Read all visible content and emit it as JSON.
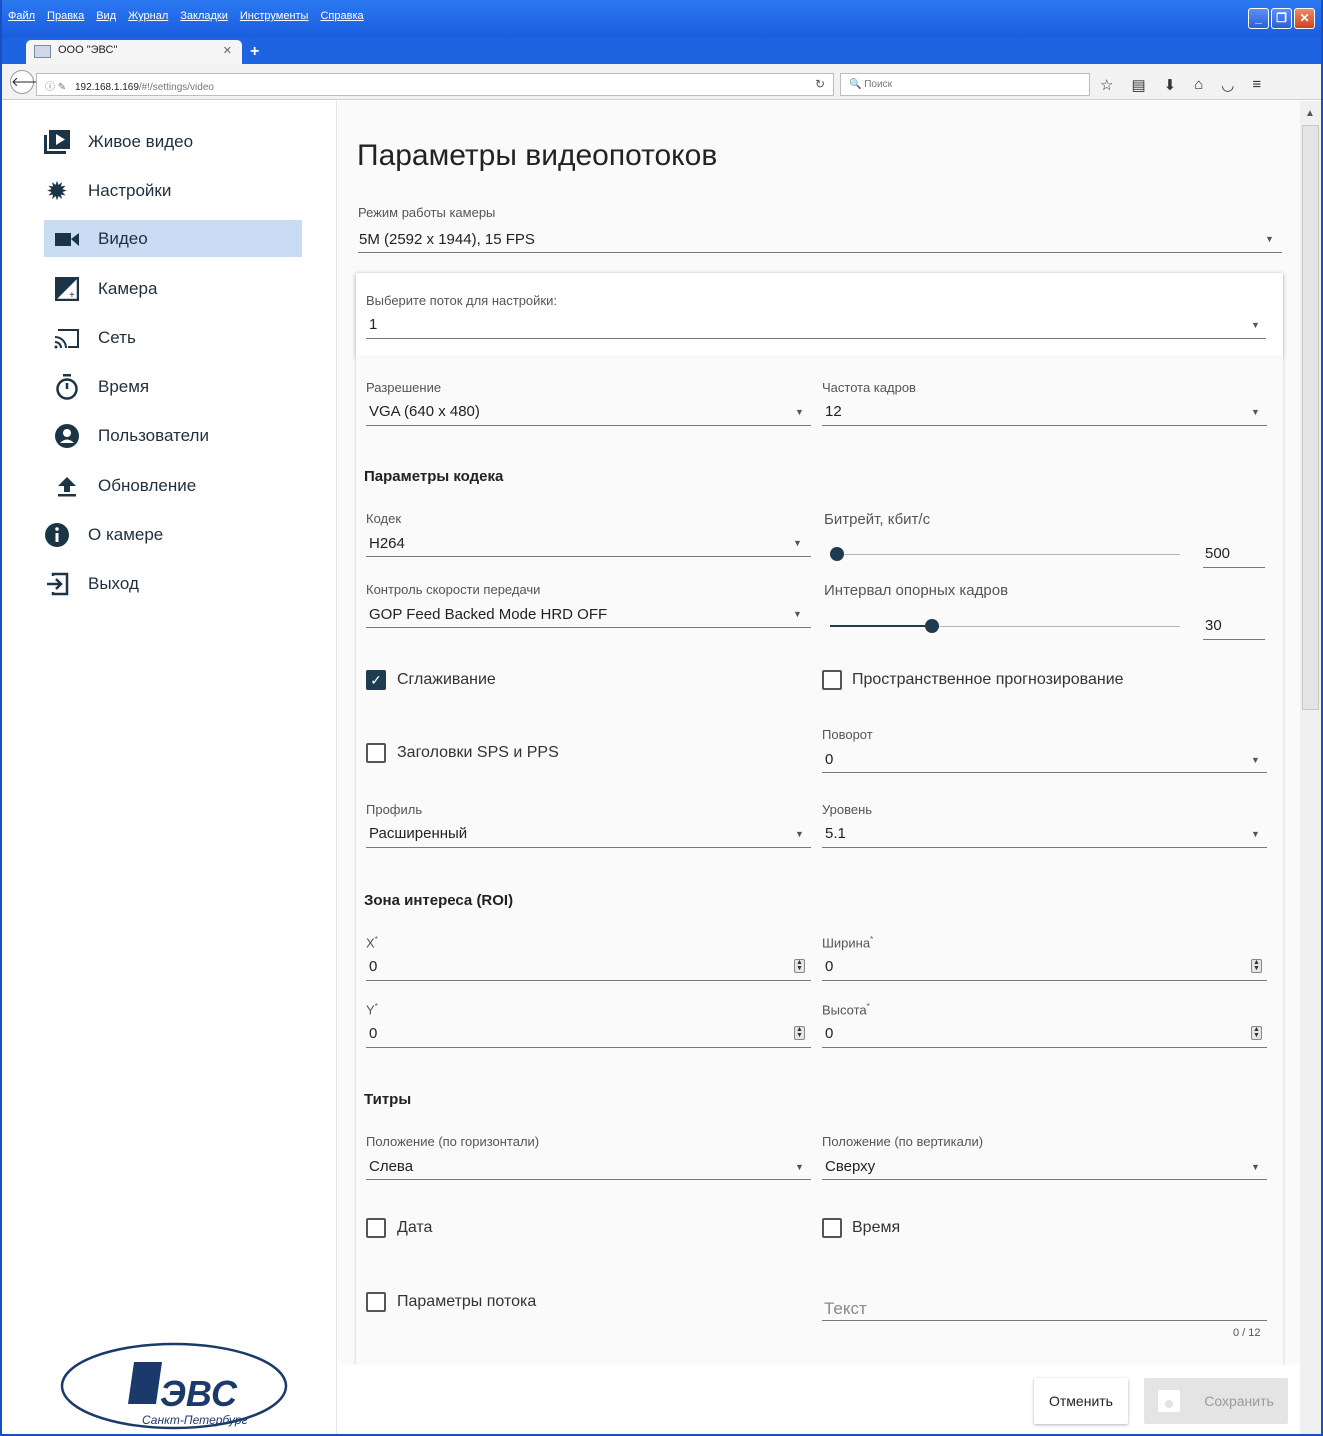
{
  "browser": {
    "menu": [
      "Файл",
      "Правка",
      "Вид",
      "Журнал",
      "Закладки",
      "Инструменты",
      "Справка"
    ],
    "tab_title": "ООО \"ЭВС\"",
    "url_host": "192.168.1.169",
    "url_path": "/#!/settings/video",
    "search_placeholder": "Поиск"
  },
  "sidebar": {
    "items": [
      {
        "label": "Живое видео",
        "icon": "video-library-icon"
      },
      {
        "label": "Настройки",
        "icon": "gear-icon"
      },
      {
        "label": "Видео",
        "icon": "videocam-icon"
      },
      {
        "label": "Камера",
        "icon": "exposure-icon"
      },
      {
        "label": "Сеть",
        "icon": "cast-icon"
      },
      {
        "label": "Время",
        "icon": "timer-icon"
      },
      {
        "label": "Пользователи",
        "icon": "account-circle-icon"
      },
      {
        "label": "Обновление",
        "icon": "upload-icon"
      },
      {
        "label": "О камере",
        "icon": "info-icon"
      },
      {
        "label": "Выход",
        "icon": "exit-icon"
      }
    ],
    "logo_text": "ЭВС",
    "logo_city": "Санкт-Петербург"
  },
  "page": {
    "title": "Параметры видеопотоков",
    "mode_label": "Режим работы камеры",
    "mode_value": "5M (2592 x 1944), 15 FPS",
    "stream_label": "Выберите поток для настройки:",
    "stream_value": "1",
    "resolution_label": "Разрешение",
    "resolution_value": "VGA (640 x 480)",
    "fps_label": "Частота кадров",
    "fps_value": "12",
    "codec_section": "Параметры кодека",
    "codec_label": "Кодек",
    "codec_value": "H264",
    "bitrate_label": "Битрейт, кбит/с",
    "bitrate_value": "500",
    "bitrate_fraction": 0.02,
    "rate_label": "Контроль скорости передачи",
    "rate_value": "GOP Feed Backed Mode HRD OFF",
    "gop_label": "Интервал опорных кадров",
    "gop_value": "30",
    "gop_fraction": 0.29,
    "smoothing_label": "Сглаживание",
    "smoothing_checked": true,
    "spatial_label": "Пространственное прогнозирование",
    "spatial_checked": false,
    "sps_label": "Заголовки SPS и PPS",
    "sps_checked": false,
    "rotation_label": "Поворот",
    "rotation_value": "0",
    "profile_label": "Профиль",
    "profile_value": "Расширенный",
    "level_label": "Уровень",
    "level_value": "5.1",
    "roi_section": "Зона интереса (ROI)",
    "x_label": "X",
    "x_value": "0",
    "width_label": "Ширина",
    "width_value": "0",
    "y_label": "Y",
    "y_value": "0",
    "height_label": "Высота",
    "height_value": "0",
    "titles_section": "Титры",
    "hpos_label": "Положение (по горизонтали)",
    "hpos_value": "Слева",
    "vpos_label": "Положение (по вертикали)",
    "vpos_value": "Сверху",
    "date_label": "Дата",
    "time_label": "Время",
    "streamparams_label": "Параметры потока",
    "text_placeholder": "Текст",
    "text_counter": "0 / 12",
    "cancel_label": "Отменить",
    "save_label": "Сохранить"
  }
}
